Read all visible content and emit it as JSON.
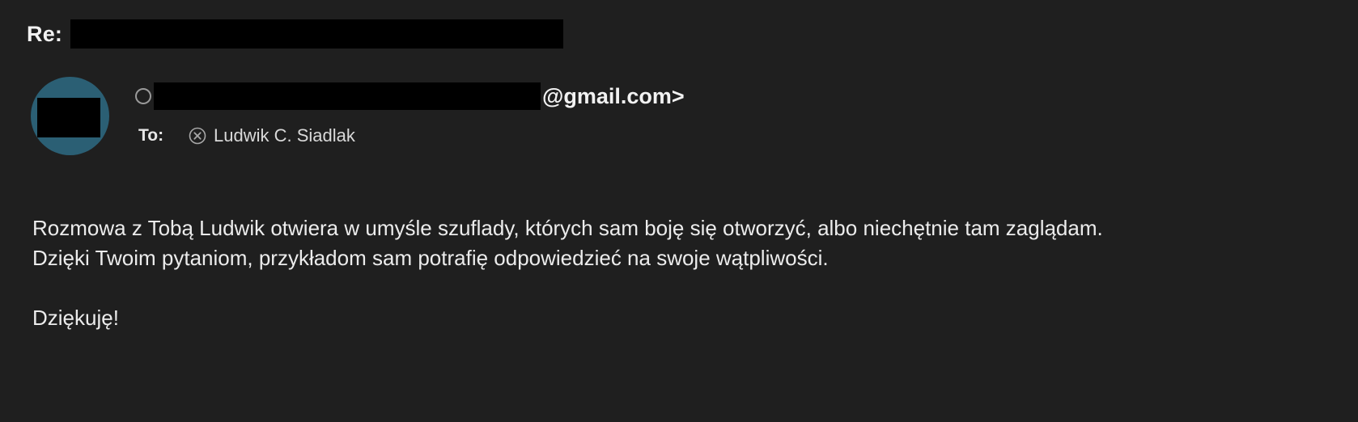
{
  "subject": {
    "prefix": "Re:"
  },
  "sender": {
    "email_domain": "@gmail.com>"
  },
  "recipients": {
    "to_label": "To:",
    "items": [
      {
        "name": "Ludwik C. Siadlak",
        "remove_icon": "circle-x-icon"
      }
    ]
  },
  "message": {
    "line1": "Rozmowa z Tobą Ludwik otwiera w umyśle szuflady, których sam boję się otworzyć, albo niechętnie tam zaglądam.",
    "line2": "Dzięki Twoim pytaniom, przykładom sam potrafię odpowiedzieć na swoje wątpliwości.",
    "line3": "Dziękuję!"
  },
  "colors": {
    "background": "#1f1f1f",
    "avatar": "#2b5f74",
    "text": "#ececec",
    "redaction": "#000000"
  }
}
